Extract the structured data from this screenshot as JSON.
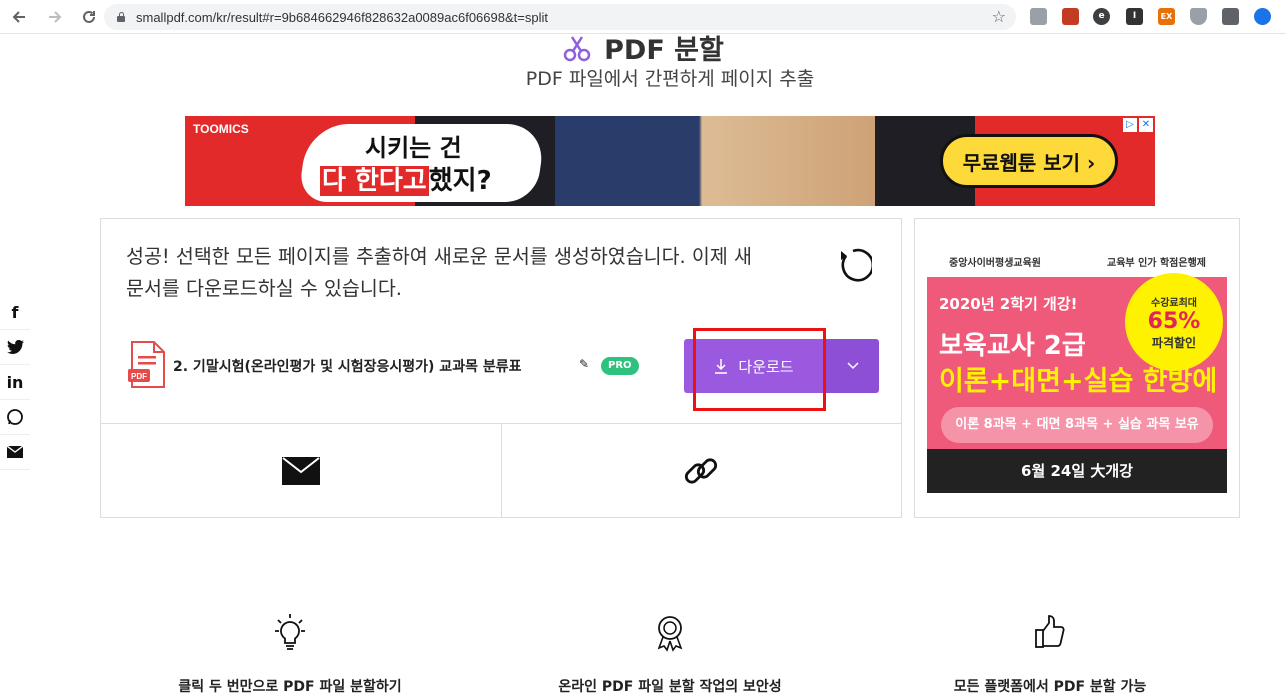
{
  "browser": {
    "url": "smallpdf.com/kr/result#r=9b684662946f828632a0089ac6f06698&t=split",
    "back_icon": "arrow-left",
    "forward_icon": "arrow-right",
    "reload_icon": "reload",
    "extensions": [
      {
        "name": "screen-ext",
        "color": "#9aa0a6",
        "glyph": ""
      },
      {
        "name": "pdf-ext",
        "color": "#c23b22",
        "glyph": ""
      },
      {
        "name": "e-ext",
        "color": "#3c4043",
        "glyph": "e"
      },
      {
        "name": "instapaper-ext",
        "color": "#333333",
        "glyph": "I"
      },
      {
        "name": "ex-ext",
        "color": "#e8710a",
        "glyph": "EX"
      },
      {
        "name": "shield-ext",
        "color": "#9aa0a6",
        "glyph": ""
      },
      {
        "name": "window-ext",
        "color": "#5f6368",
        "glyph": ""
      },
      {
        "name": "chart-ext",
        "color": "#1a73e8",
        "glyph": ""
      },
      {
        "name": "face-ext",
        "color": "#d93025",
        "glyph": ""
      }
    ]
  },
  "page": {
    "title": "PDF 분할",
    "subtitle": "PDF 파일에서 간편하게 페이지 추출"
  },
  "top_ad": {
    "brand": "TOOMICS",
    "line1": "시키는 건",
    "line2_highlight": "다 한다고",
    "line2_rest": "했지?",
    "cta": "무료웹툰 보기 ›"
  },
  "share": [
    "f",
    "t",
    "in",
    "w",
    "m"
  ],
  "result": {
    "message": "성공! 선택한 모든 페이지를 추출하여 새로운 문서를 생성하였습니다. 이제 새 문서를 다운로드하실 수 있습니다.",
    "file_name": "2. 기말시험(온라인평가 및 시험장응시평가) 교과목 분류표",
    "pro_badge": "PRO",
    "download_label": "다운로드",
    "file_type": "PDF"
  },
  "side_ad": {
    "school": "중앙사이버평생교육원",
    "ministry": "교육부 인가 학점은행제",
    "semester": "2020년 2학기 개강!",
    "headline1": "보육교사 2급",
    "headline2": "이론+대면+실습 한방에",
    "seal_top": "수강료최대",
    "seal_pct": "65%",
    "seal_bottom": "파격할인",
    "courses": "이론 8과목 + 대면 8과목 + 실습 과목 보유",
    "footer": "6월 24일 大개강"
  },
  "features": [
    {
      "icon": "lightbulb-icon",
      "label": "클릭 두 번만으로 PDF 파일 분할하기"
    },
    {
      "icon": "award-icon",
      "label": "온라인 PDF 파일 분할 작업의 보안성"
    },
    {
      "icon": "thumbs-up-icon",
      "label": "모든 플랫폼에서 PDF 분할 가능"
    }
  ],
  "colors": {
    "accent": "#9b59e0",
    "highlight": "#ee1111",
    "pro": "#2ec27e"
  }
}
